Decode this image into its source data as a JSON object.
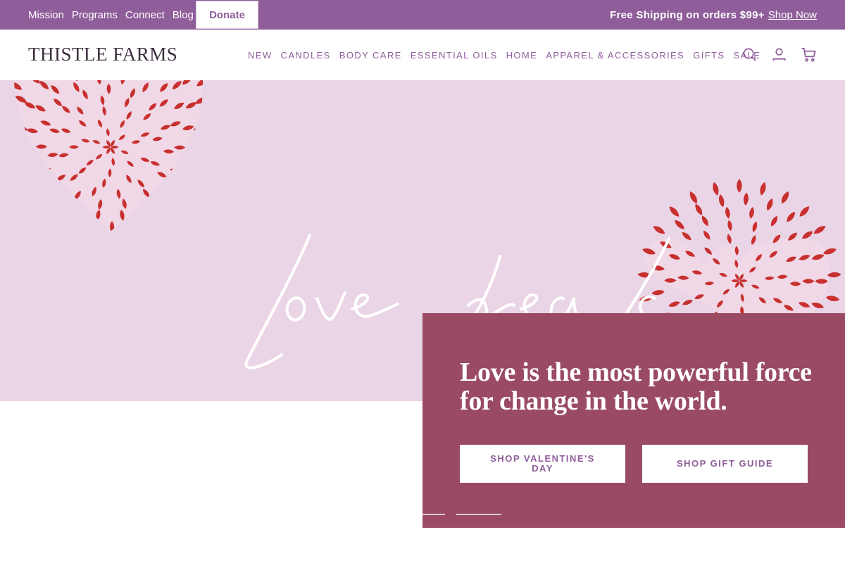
{
  "topbar": {
    "links": [
      "Mission",
      "Programs",
      "Connect",
      "Blog"
    ],
    "donate_label": "Donate",
    "promo_text": "Free Shipping on orders $99+",
    "promo_link": "Shop Now"
  },
  "header": {
    "logo": "THISTLE FARMS",
    "nav": [
      "NEW",
      "CANDLES",
      "BODY CARE",
      "ESSENTIAL OILS",
      "HOME",
      "APPAREL & ACCESSORIES",
      "GIFTS",
      "SALE"
    ],
    "icons": [
      "search-icon",
      "account-icon",
      "cart-icon"
    ]
  },
  "hero": {
    "script_text": "Love heals",
    "heading": "Love is the most powerful force for change in the world.",
    "buttons": [
      "SHOP VALENTINE'S DAY",
      "SHOP GIFT GUIDE"
    ],
    "slides": 2
  },
  "colors": {
    "brand_purple": "#8f5d9a",
    "hero_bg": "#ead5e6",
    "card_bg": "#9a4b63",
    "petal_red": "#c8302f"
  }
}
